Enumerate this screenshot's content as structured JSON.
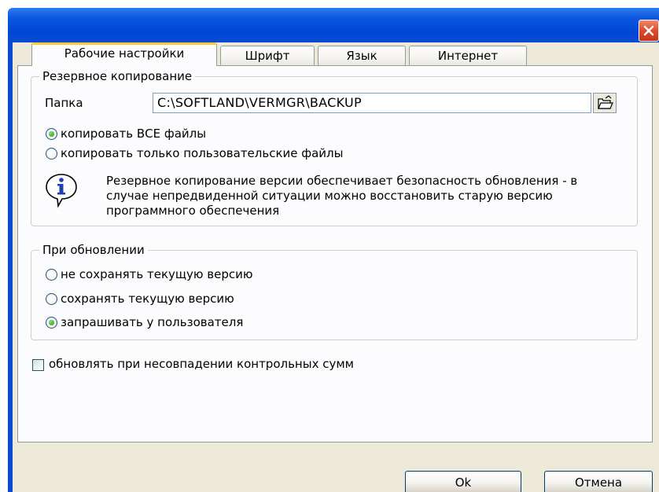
{
  "window": {
    "title": "",
    "close_icon": "close-icon"
  },
  "tabs": [
    {
      "label": "Рабочие настройки",
      "active": true
    },
    {
      "label": "Шрифт",
      "active": false
    },
    {
      "label": "Язык",
      "active": false
    },
    {
      "label": "Интернет",
      "active": false
    }
  ],
  "backup": {
    "legend": "Резервное копирование",
    "folder_label": "Папка",
    "folder_value": "C:\\SOFTLAND\\VERMGR\\BACKUP",
    "browse_icon": "open-folder-icon",
    "options": [
      {
        "label": "копировать ВСЕ файлы",
        "checked": true
      },
      {
        "label": "копировать только пользовательские файлы",
        "checked": false
      }
    ],
    "info_icon": "info-icon",
    "info_text": "Резервное копирование версии обеспечивает безопасность обновления - в случае непредвиденной ситуации можно восстановить старую версию программного обеспечения"
  },
  "update": {
    "legend": "При обновлении",
    "options": [
      {
        "label": "не сохранять текущую версию",
        "checked": false
      },
      {
        "label": "сохранять текущую версию",
        "checked": false
      },
      {
        "label": "запрашивать у пользователя",
        "checked": true
      }
    ]
  },
  "checksum": {
    "label": "обновлять при несовпадении контрольных сумм",
    "checked": false
  },
  "buttons": {
    "ok": "Ok",
    "cancel": "Отмена"
  },
  "colors": {
    "titlebar": "#0a4ad0",
    "dialog_bg": "#ece9d8",
    "tab_highlight": "#ffc83c",
    "radio_check": "#2f9a20"
  }
}
